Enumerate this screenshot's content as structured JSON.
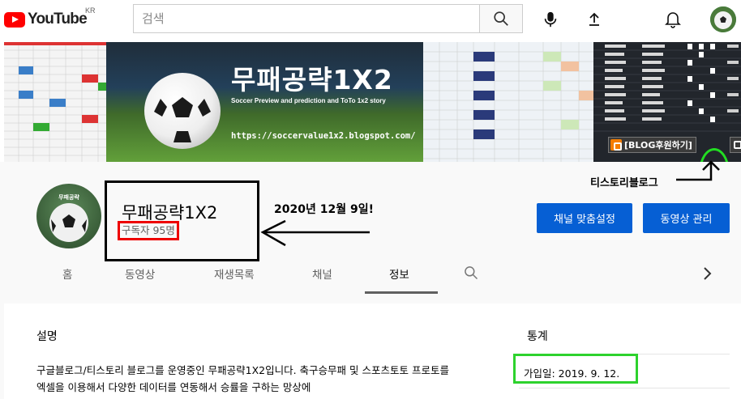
{
  "header": {
    "logo_text": "YouTube",
    "logo_region": "KR",
    "search_placeholder": "검색"
  },
  "banner": {
    "title": "무패공략1X2",
    "subtitle": "Soccer Preview and prediction and ToTo 1x2 story",
    "url": "https://soccervalue1x2.blogspot.com/",
    "blog_button_label": "[BLOG후원하기]"
  },
  "channel": {
    "name": "무패공략1X2",
    "subscribers": "구독자 95명",
    "avatar_label": "무패공략",
    "annotation_date": "2020년 12월 9일!",
    "annotation_tistory": "티스토리블로그",
    "customize_button": "채널 맞춤설정",
    "manage_button": "동영상 관리"
  },
  "tabs": [
    "홈",
    "동영상",
    "재생목록",
    "채널",
    "정보"
  ],
  "active_tab": "정보",
  "about": {
    "description_heading": "설명",
    "description_text": "구글블로그/티스토리 블로그를 운영중인 무패공략1X2입니다. 축구승무패 및 스포츠토토 프로토를 엑셀을 이용해서 다양한 데이터를 연동해서 승률을 구하는 망상에",
    "stats_heading": "통계",
    "joined": "가입일: 2019. 9. 12."
  },
  "colors": {
    "youtube_red": "#ff0000",
    "primary_blue": "#065fd4",
    "annotation_red": "#ee0000",
    "annotation_green": "#2dd22d"
  }
}
